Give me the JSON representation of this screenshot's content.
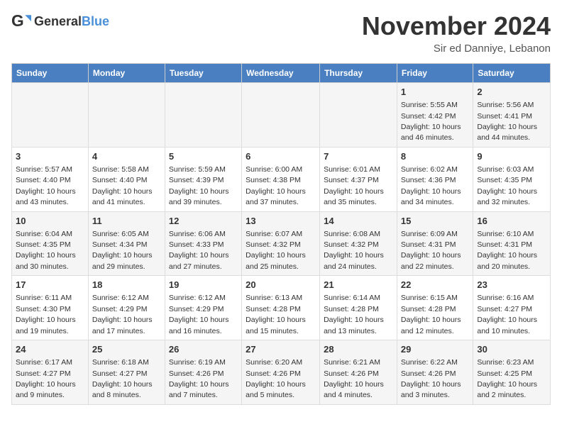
{
  "logo": {
    "text_general": "General",
    "text_blue": "Blue"
  },
  "title": "November 2024",
  "subtitle": "Sir ed Danniye, Lebanon",
  "days_of_week": [
    "Sunday",
    "Monday",
    "Tuesday",
    "Wednesday",
    "Thursday",
    "Friday",
    "Saturday"
  ],
  "weeks": [
    [
      {
        "day": "",
        "info": ""
      },
      {
        "day": "",
        "info": ""
      },
      {
        "day": "",
        "info": ""
      },
      {
        "day": "",
        "info": ""
      },
      {
        "day": "",
        "info": ""
      },
      {
        "day": "1",
        "info": "Sunrise: 5:55 AM\nSunset: 4:42 PM\nDaylight: 10 hours\nand 46 minutes."
      },
      {
        "day": "2",
        "info": "Sunrise: 5:56 AM\nSunset: 4:41 PM\nDaylight: 10 hours\nand 44 minutes."
      }
    ],
    [
      {
        "day": "3",
        "info": "Sunrise: 5:57 AM\nSunset: 4:40 PM\nDaylight: 10 hours\nand 43 minutes."
      },
      {
        "day": "4",
        "info": "Sunrise: 5:58 AM\nSunset: 4:40 PM\nDaylight: 10 hours\nand 41 minutes."
      },
      {
        "day": "5",
        "info": "Sunrise: 5:59 AM\nSunset: 4:39 PM\nDaylight: 10 hours\nand 39 minutes."
      },
      {
        "day": "6",
        "info": "Sunrise: 6:00 AM\nSunset: 4:38 PM\nDaylight: 10 hours\nand 37 minutes."
      },
      {
        "day": "7",
        "info": "Sunrise: 6:01 AM\nSunset: 4:37 PM\nDaylight: 10 hours\nand 35 minutes."
      },
      {
        "day": "8",
        "info": "Sunrise: 6:02 AM\nSunset: 4:36 PM\nDaylight: 10 hours\nand 34 minutes."
      },
      {
        "day": "9",
        "info": "Sunrise: 6:03 AM\nSunset: 4:35 PM\nDaylight: 10 hours\nand 32 minutes."
      }
    ],
    [
      {
        "day": "10",
        "info": "Sunrise: 6:04 AM\nSunset: 4:35 PM\nDaylight: 10 hours\nand 30 minutes."
      },
      {
        "day": "11",
        "info": "Sunrise: 6:05 AM\nSunset: 4:34 PM\nDaylight: 10 hours\nand 29 minutes."
      },
      {
        "day": "12",
        "info": "Sunrise: 6:06 AM\nSunset: 4:33 PM\nDaylight: 10 hours\nand 27 minutes."
      },
      {
        "day": "13",
        "info": "Sunrise: 6:07 AM\nSunset: 4:32 PM\nDaylight: 10 hours\nand 25 minutes."
      },
      {
        "day": "14",
        "info": "Sunrise: 6:08 AM\nSunset: 4:32 PM\nDaylight: 10 hours\nand 24 minutes."
      },
      {
        "day": "15",
        "info": "Sunrise: 6:09 AM\nSunset: 4:31 PM\nDaylight: 10 hours\nand 22 minutes."
      },
      {
        "day": "16",
        "info": "Sunrise: 6:10 AM\nSunset: 4:31 PM\nDaylight: 10 hours\nand 20 minutes."
      }
    ],
    [
      {
        "day": "17",
        "info": "Sunrise: 6:11 AM\nSunset: 4:30 PM\nDaylight: 10 hours\nand 19 minutes."
      },
      {
        "day": "18",
        "info": "Sunrise: 6:12 AM\nSunset: 4:29 PM\nDaylight: 10 hours\nand 17 minutes."
      },
      {
        "day": "19",
        "info": "Sunrise: 6:12 AM\nSunset: 4:29 PM\nDaylight: 10 hours\nand 16 minutes."
      },
      {
        "day": "20",
        "info": "Sunrise: 6:13 AM\nSunset: 4:28 PM\nDaylight: 10 hours\nand 15 minutes."
      },
      {
        "day": "21",
        "info": "Sunrise: 6:14 AM\nSunset: 4:28 PM\nDaylight: 10 hours\nand 13 minutes."
      },
      {
        "day": "22",
        "info": "Sunrise: 6:15 AM\nSunset: 4:28 PM\nDaylight: 10 hours\nand 12 minutes."
      },
      {
        "day": "23",
        "info": "Sunrise: 6:16 AM\nSunset: 4:27 PM\nDaylight: 10 hours\nand 10 minutes."
      }
    ],
    [
      {
        "day": "24",
        "info": "Sunrise: 6:17 AM\nSunset: 4:27 PM\nDaylight: 10 hours\nand 9 minutes."
      },
      {
        "day": "25",
        "info": "Sunrise: 6:18 AM\nSunset: 4:27 PM\nDaylight: 10 hours\nand 8 minutes."
      },
      {
        "day": "26",
        "info": "Sunrise: 6:19 AM\nSunset: 4:26 PM\nDaylight: 10 hours\nand 7 minutes."
      },
      {
        "day": "27",
        "info": "Sunrise: 6:20 AM\nSunset: 4:26 PM\nDaylight: 10 hours\nand 5 minutes."
      },
      {
        "day": "28",
        "info": "Sunrise: 6:21 AM\nSunset: 4:26 PM\nDaylight: 10 hours\nand 4 minutes."
      },
      {
        "day": "29",
        "info": "Sunrise: 6:22 AM\nSunset: 4:26 PM\nDaylight: 10 hours\nand 3 minutes."
      },
      {
        "day": "30",
        "info": "Sunrise: 6:23 AM\nSunset: 4:25 PM\nDaylight: 10 hours\nand 2 minutes."
      }
    ]
  ]
}
